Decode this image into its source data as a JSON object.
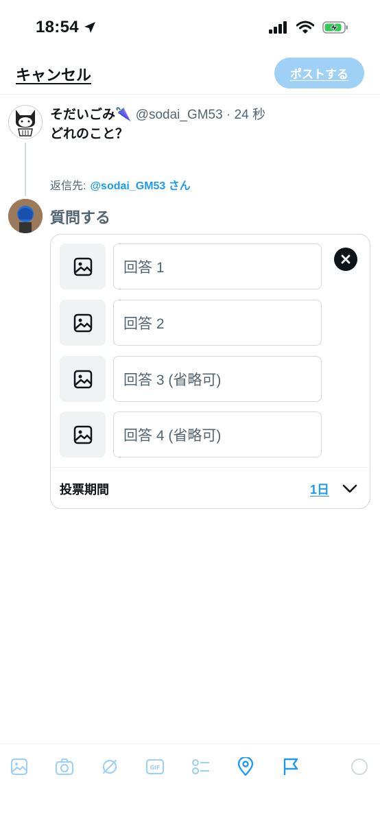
{
  "status_bar": {
    "time": "18:54"
  },
  "header": {
    "cancel_label": "キャンセル",
    "post_label": "ポストする"
  },
  "tweet": {
    "author_name": "そだいごみ🌂",
    "author_meta": "@sodai_GM53 · 24 秒",
    "text": "どれのこと？"
  },
  "reply": {
    "prefix": "返信先:",
    "handle": "@sodai_GM53 さん"
  },
  "compose": {
    "placeholder": "質問する"
  },
  "poll": {
    "choices": [
      {
        "placeholder": "回答 1"
      },
      {
        "placeholder": "回答 2"
      },
      {
        "placeholder": "回答 3 (省略可)"
      },
      {
        "placeholder": "回答 4 (省略可)"
      }
    ],
    "duration_label": "投票期間",
    "duration_value": "1日"
  },
  "toolbar": {
    "icons": [
      "image-icon",
      "camera-icon",
      "grok-icon",
      "gif-icon",
      "poll-icon",
      "location-icon",
      "flag-icon",
      "character-counter"
    ]
  },
  "colors": {
    "accent": "#1d9bf0",
    "post_disabled": "#9fd0f6",
    "muted": "#536471"
  }
}
